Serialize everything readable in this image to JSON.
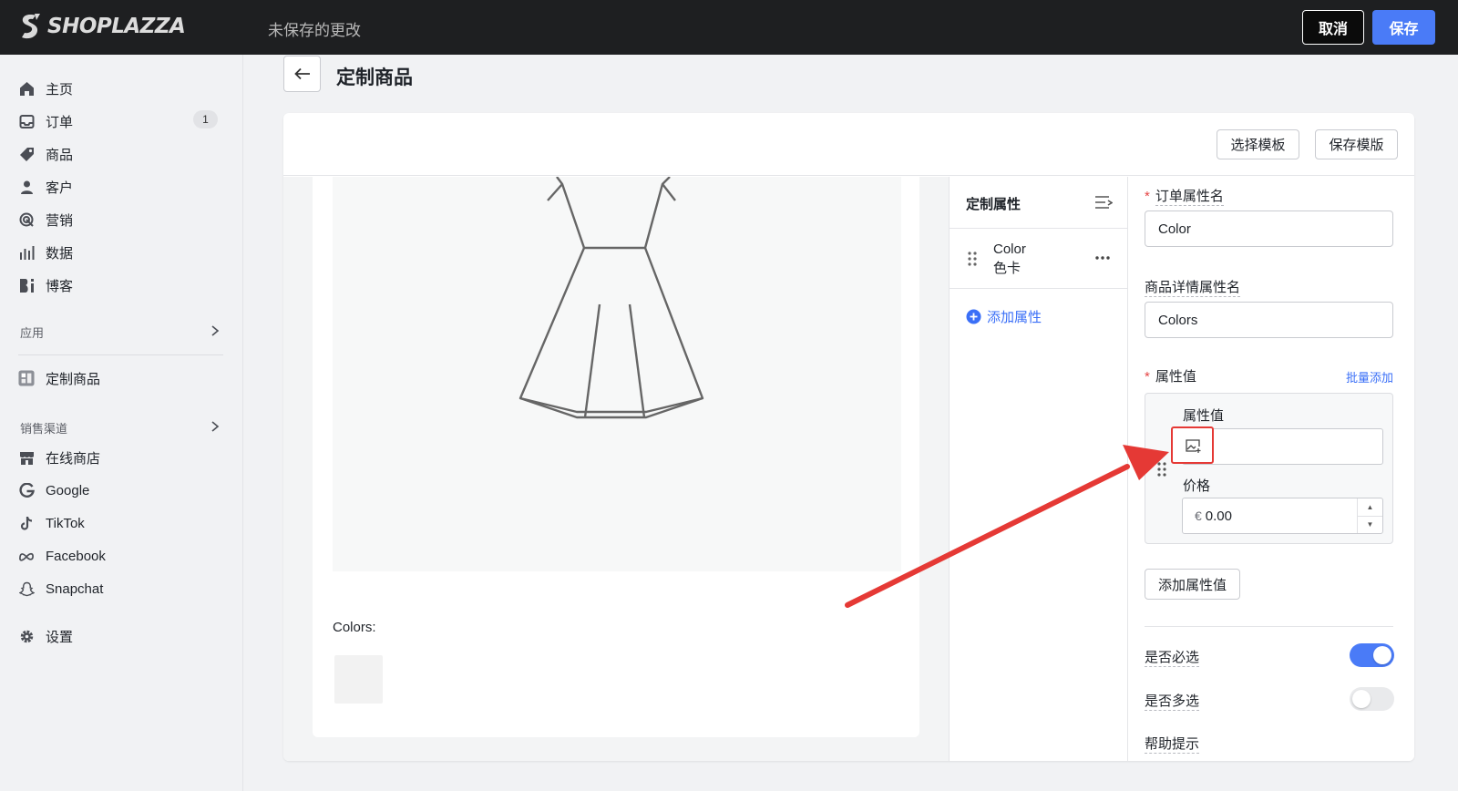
{
  "topbar": {
    "logo_text": "SHOPLAZZA",
    "unsaved_text": "未保存的更改",
    "cancel_label": "取消",
    "save_label": "保存"
  },
  "sidebar": {
    "items": [
      {
        "label": "主页",
        "icon": "home-icon"
      },
      {
        "label": "订单",
        "icon": "inbox-icon",
        "badge": "1"
      },
      {
        "label": "商品",
        "icon": "tag-icon"
      },
      {
        "label": "客户",
        "icon": "person-icon"
      },
      {
        "label": "营销",
        "icon": "target-icon"
      },
      {
        "label": "数据",
        "icon": "bar-chart-icon"
      },
      {
        "label": "博客",
        "icon": "blog-icon"
      }
    ],
    "apps_label": "应用",
    "app_item": "定制商品",
    "channels_label": "销售渠道",
    "channels": [
      {
        "label": "在线商店",
        "icon": "store-icon"
      },
      {
        "label": "Google",
        "icon": "google-icon"
      },
      {
        "label": "TikTok",
        "icon": "tiktok-icon"
      },
      {
        "label": "Facebook",
        "icon": "meta-icon"
      },
      {
        "label": "Snapchat",
        "icon": "snapchat-icon"
      }
    ],
    "settings_label": "设置"
  },
  "header": {
    "title": "定制商品"
  },
  "toolbar": {
    "select_template": "选择模板",
    "save_template": "保存模版"
  },
  "preview": {
    "colors_label": "Colors:"
  },
  "attributes": {
    "title": "定制属性",
    "items": [
      {
        "name": "Color",
        "sub": "色卡"
      }
    ],
    "add_label": "添加属性"
  },
  "form": {
    "order_attr_label": "订单属性名",
    "order_attr_value": "Color",
    "detail_attr_label": "商品详情属性名",
    "detail_attr_value": "Colors",
    "attr_value_label": "属性值",
    "batch_add": "批量添加",
    "value_box": {
      "value_label": "属性值",
      "price_label": "价格",
      "currency": "€",
      "price_value": "0.00"
    },
    "add_value_label": "添加属性值",
    "required_label": "是否必选",
    "required_on": true,
    "multi_label": "是否多选",
    "multi_on": false,
    "help_label": "帮助提示"
  },
  "colors": {
    "accent": "#4a7bf7",
    "topbar": "#1e1f21",
    "highlight": "#e53935"
  }
}
